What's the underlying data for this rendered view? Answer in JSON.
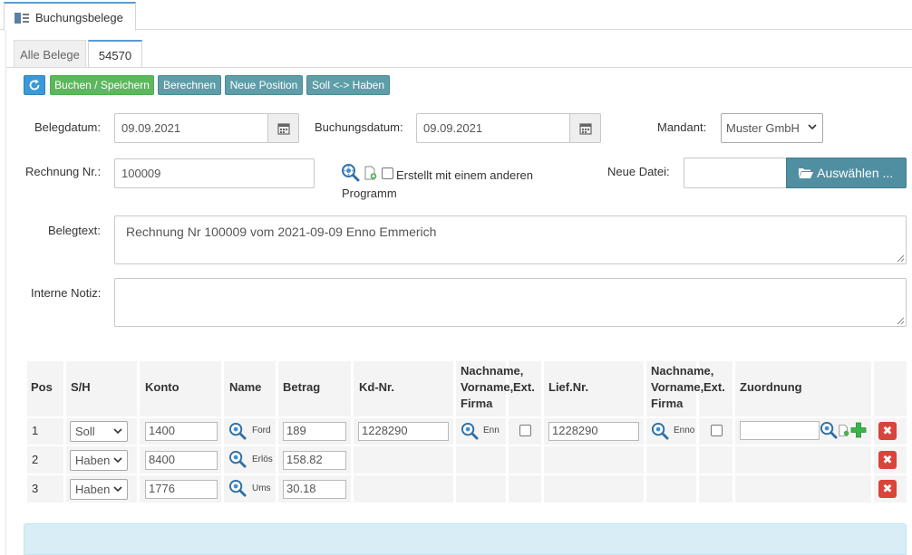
{
  "window": {
    "tab_title": "Buchungsbelege"
  },
  "tabs": [
    {
      "label": "Alle Belege",
      "active": false
    },
    {
      "label": "54570",
      "active": true
    }
  ],
  "toolbar": {
    "refresh_icon": "refresh-icon",
    "save_label": "Buchen / Speichern",
    "calc_label": "Berechnen",
    "new_pos_label": "Neue Position",
    "swap_label": "Soll <-> Haben"
  },
  "form": {
    "belegdatum_label": "Belegdatum:",
    "belegdatum_value": "09.09.2021",
    "buchungsdatum_label": "Buchungsdatum:",
    "buchungsdatum_value": "09.09.2021",
    "mandant_label": "Mandant:",
    "mandant_value": "Muster GmbH",
    "rechnung_label": "Rechnung Nr.:",
    "rechnung_value": "100009",
    "ext_prog_label": "Erstellt mit einem anderen",
    "ext_prog_label2": "Programm",
    "neue_datei_label": "Neue Datei:",
    "choose_label": "Auswählen ...",
    "belegtext_label": "Belegtext:",
    "belegtext_value": "Rechnung Nr 100009 vom 2021-09-09 Enno Emmerich",
    "notiz_label": "Interne Notiz:",
    "notiz_value": ""
  },
  "table": {
    "headers": {
      "pos": "Pos",
      "sh": "S/H",
      "konto": "Konto",
      "name": "Name",
      "betrag": "Betrag",
      "kdnr": "Kd-Nr.",
      "name2_line1": "Nachname,",
      "name2_line2": "Vorname,",
      "name2_line3": "Firma",
      "ext": "Ext.",
      "liefnr": "Lief.Nr.",
      "name3_line1": "Nachname,",
      "name3_line2": "Vorname,",
      "name3_line3": "Firma",
      "ext2": "Ext.",
      "zuordnung": "Zuordnung"
    },
    "rows": [
      {
        "pos": "1",
        "sh": "Soll",
        "konto": "1400",
        "name": "Ford",
        "betrag": "189",
        "kdnr": "1228290",
        "kd_name": "Enn",
        "liefnr": "1228290",
        "lief_name": "Enno",
        "zuordnung": ""
      },
      {
        "pos": "2",
        "sh": "Haben",
        "konto": "8400",
        "name": "Erlös",
        "betrag": "158.82"
      },
      {
        "pos": "3",
        "sh": "Haben",
        "konto": "1776",
        "name": "Ums",
        "betrag": "30.18"
      }
    ],
    "delete_glyph": "✖"
  },
  "colors": {
    "save_green": "#5cb85c",
    "teal": "#5d9ea8",
    "blue": "#3a9ad9",
    "delete_red": "#d9443b",
    "info_bg": "#d9edf7"
  }
}
